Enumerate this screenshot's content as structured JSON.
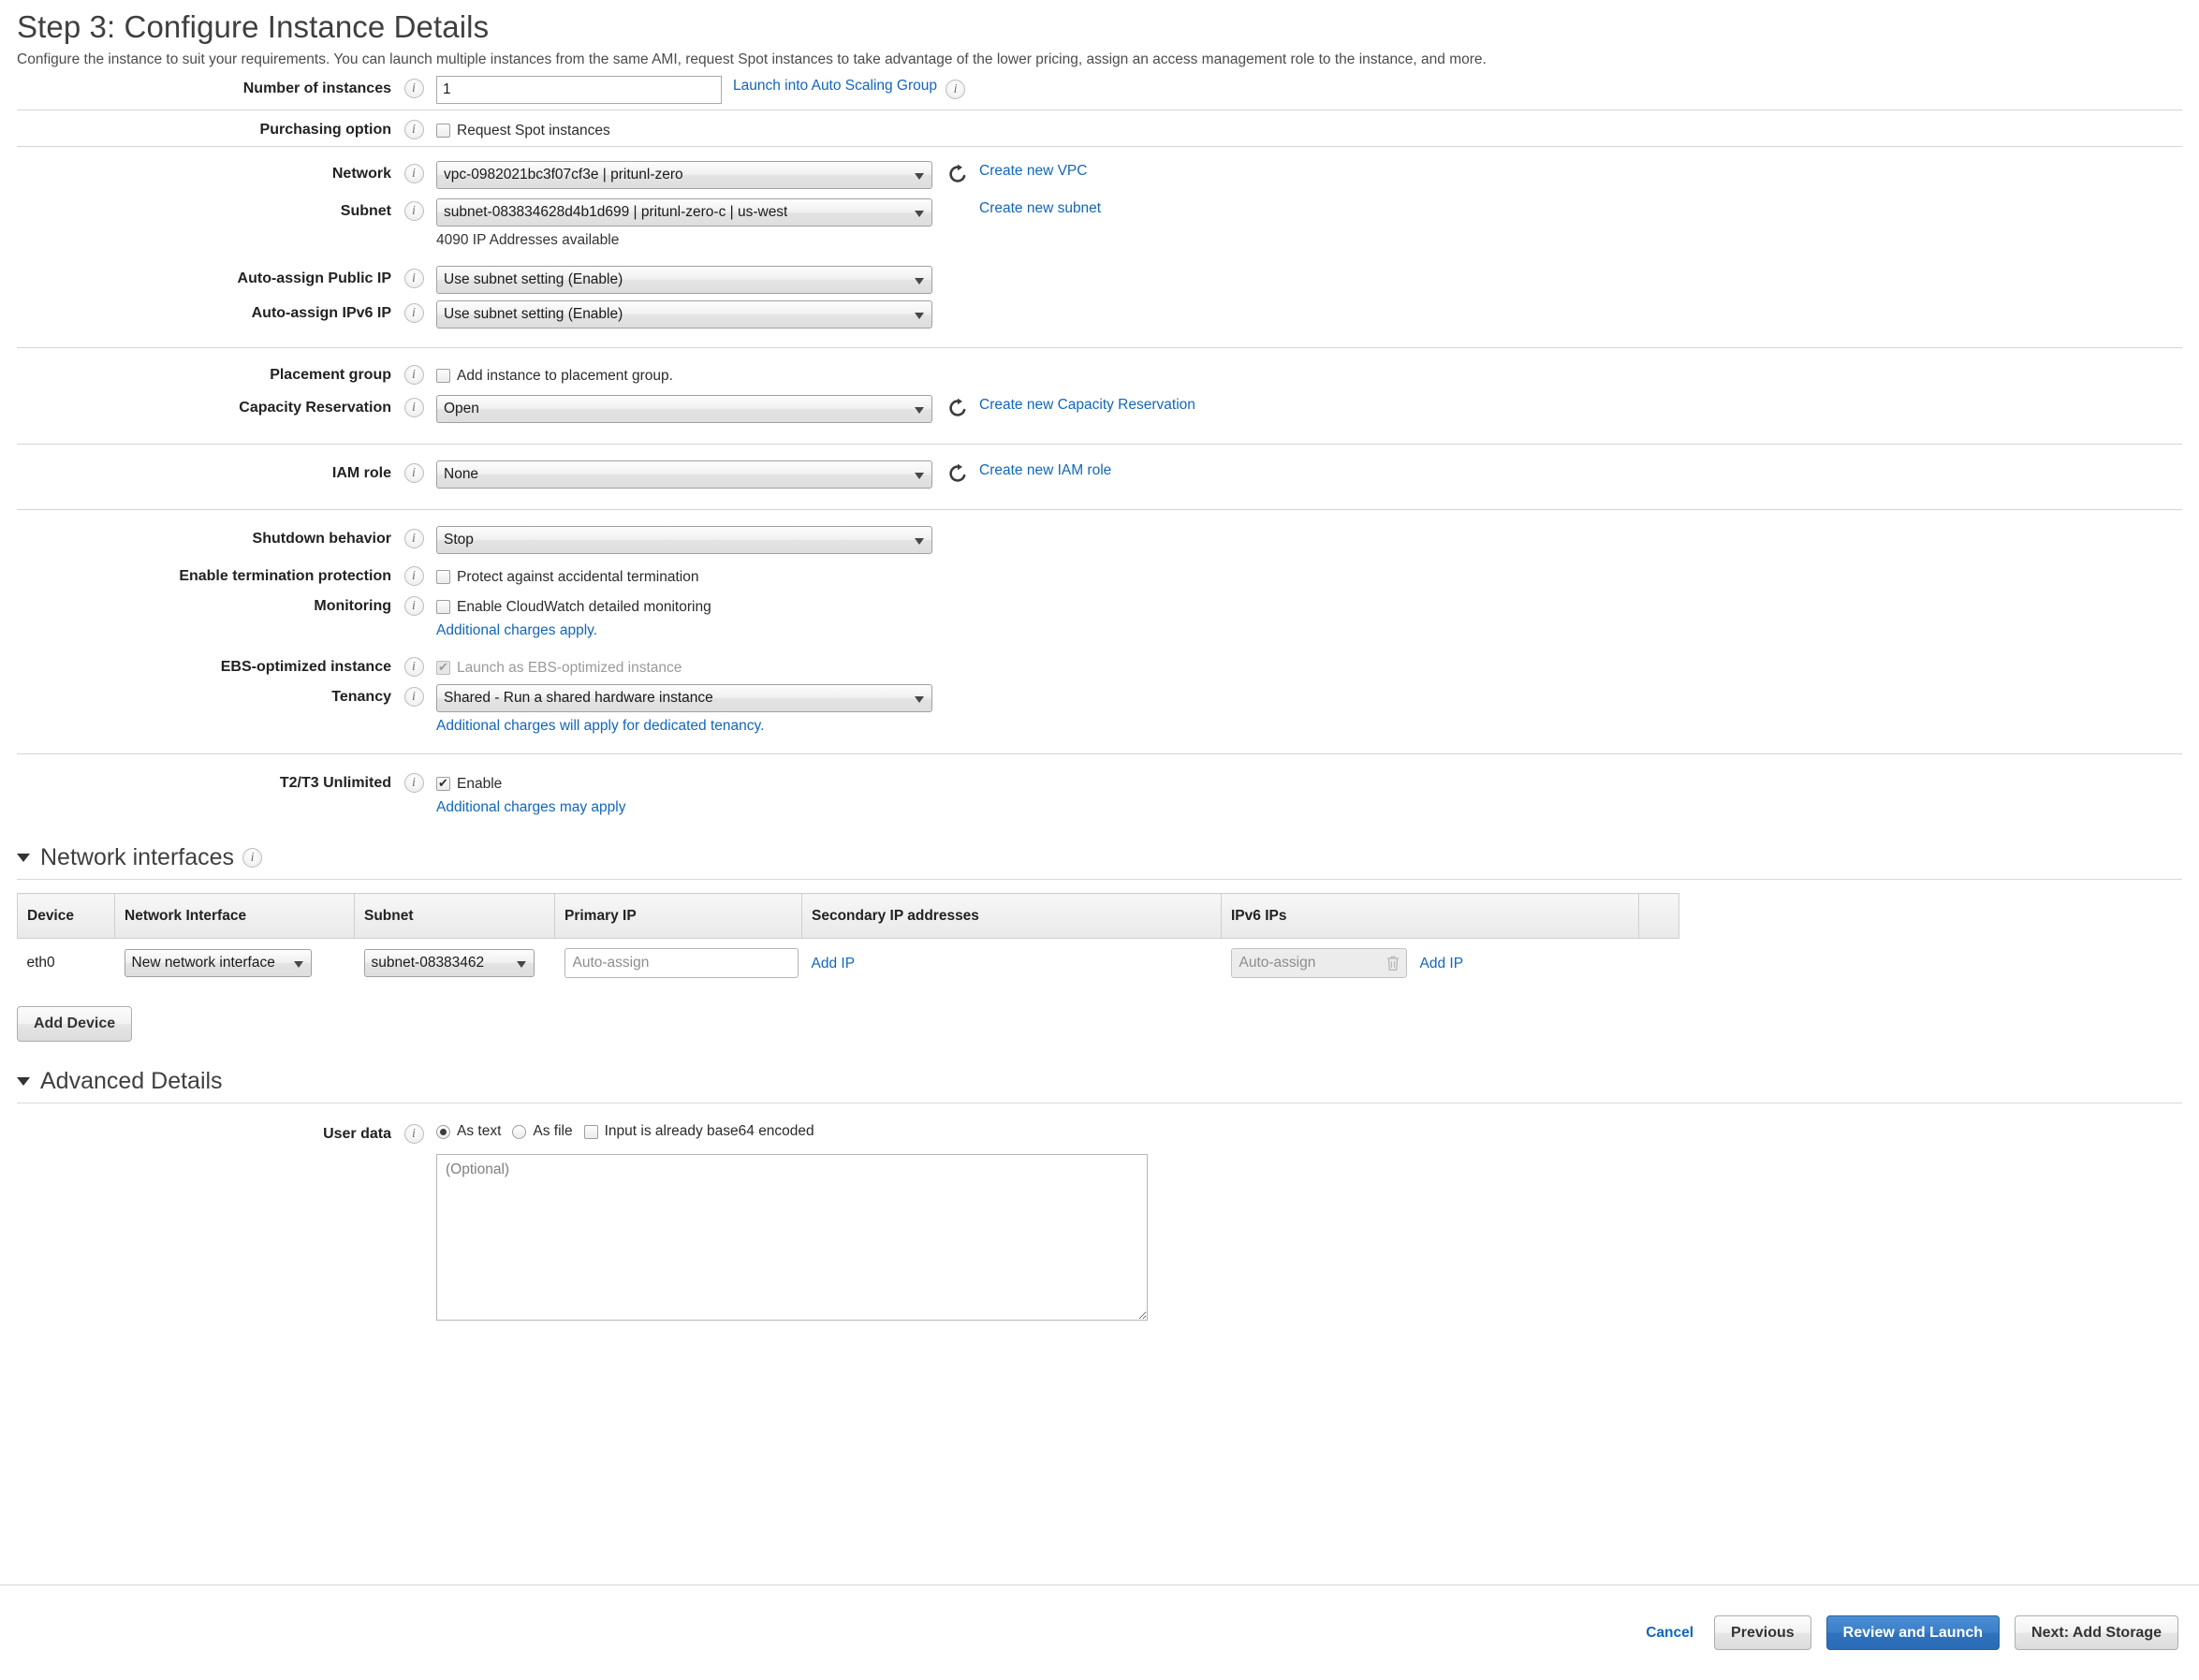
{
  "header": {
    "title": "Step 3: Configure Instance Details",
    "subtitle": "Configure the instance to suit your requirements. You can launch multiple instances from the same AMI, request Spot instances to take advantage of the lower pricing, assign an access management role to the instance, and more."
  },
  "colors": {
    "link": "#1166bb",
    "primary_button": "#3a7fc8",
    "rule": "#d5d5d5"
  },
  "icons": {
    "info": "info-icon",
    "refresh": "refresh-icon",
    "trash": "trash-icon",
    "caret": "chevron-down-icon",
    "disclosure": "triangle-down-icon"
  },
  "fields": {
    "number_of_instances": {
      "label": "Number of instances",
      "value": "1",
      "link": "Launch into Auto Scaling Group"
    },
    "purchasing_option": {
      "label": "Purchasing option",
      "checkbox_label": "Request Spot instances",
      "checked": false
    },
    "network": {
      "label": "Network",
      "value": "vpc-0982021bc3f07cf3e | pritunl-zero",
      "link": "Create new VPC"
    },
    "subnet": {
      "label": "Subnet",
      "value": "subnet-083834628d4b1d699 | pritunl-zero-c | us-west",
      "link": "Create new subnet",
      "note": "4090 IP Addresses available"
    },
    "auto_assign_public_ip": {
      "label": "Auto-assign Public IP",
      "value": "Use subnet setting (Enable)"
    },
    "auto_assign_ipv6_ip": {
      "label": "Auto-assign IPv6 IP",
      "value": "Use subnet setting (Enable)"
    },
    "placement_group": {
      "label": "Placement group",
      "checkbox_label": "Add instance to placement group.",
      "checked": false
    },
    "capacity_reservation": {
      "label": "Capacity Reservation",
      "value": "Open",
      "link": "Create new Capacity Reservation"
    },
    "iam_role": {
      "label": "IAM role",
      "value": "None",
      "link": "Create new IAM role"
    },
    "shutdown_behavior": {
      "label": "Shutdown behavior",
      "value": "Stop"
    },
    "termination_protection": {
      "label": "Enable termination protection",
      "checkbox_label": "Protect against accidental termination",
      "checked": false
    },
    "monitoring": {
      "label": "Monitoring",
      "checkbox_label": "Enable CloudWatch detailed monitoring",
      "checked": false,
      "note_link": "Additional charges apply."
    },
    "ebs_optimized": {
      "label": "EBS-optimized instance",
      "checkbox_label": "Launch as EBS-optimized instance",
      "checked": true,
      "disabled": true
    },
    "tenancy": {
      "label": "Tenancy",
      "value": "Shared - Run a shared hardware instance",
      "note_link": "Additional charges will apply for dedicated tenancy."
    },
    "t2_t3_unlimited": {
      "label": "T2/T3 Unlimited",
      "checkbox_label": "Enable",
      "checked": true,
      "note_link": "Additional charges may apply"
    }
  },
  "network_interfaces": {
    "section_title": "Network interfaces",
    "columns": [
      "Device",
      "Network Interface",
      "Subnet",
      "Primary IP",
      "Secondary IP addresses",
      "IPv6 IPs",
      ""
    ],
    "rows": [
      {
        "device": "eth0",
        "network_interface": "New network interface",
        "subnet": "subnet-08383462",
        "primary_ip_placeholder": "Auto-assign",
        "primary_ip_value": "",
        "secondary_add_ip": "Add IP",
        "ipv6_value": "Auto-assign",
        "ipv6_add_ip": "Add IP"
      }
    ],
    "add_device_button": "Add Device"
  },
  "advanced_details": {
    "section_title": "Advanced Details",
    "user_data": {
      "label": "User data",
      "radio_as_text": "As text",
      "radio_as_file": "As file",
      "selected_radio": "As text",
      "checkbox_base64": "Input is already base64 encoded",
      "base64_checked": false,
      "textarea_placeholder": "(Optional)",
      "textarea_value": ""
    }
  },
  "footer": {
    "cancel": "Cancel",
    "previous": "Previous",
    "review_and_launch": "Review and Launch",
    "next": "Next: Add Storage"
  }
}
